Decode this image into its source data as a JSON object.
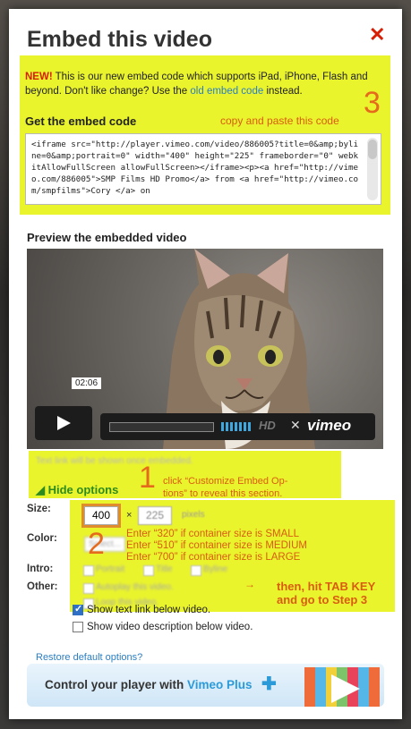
{
  "modal": {
    "title": "Embed this video",
    "close_label": "✕"
  },
  "embed": {
    "new_badge": "NEW!",
    "intro_text": " This is our new embed code which supports iPad, iPhone, Flash and beyond. Don't like change? Use the ",
    "old_link": "old embed code",
    "intro_end": " instead.",
    "heading": "Get the embed code",
    "code": "<iframe src=\"http://player.vimeo.com/video/886005?title=0&amp;byline=0&amp;portrait=0\" width=\"400\" height=\"225\" frameborder=\"0\" webkitAllowFullScreen allowFullScreen></iframe><p><a href=\"http://vimeo.com/886005\">SMP Films HD Promo</a> from <a href=\"http://vimeo.com/smpfilms\">Cory </a> on "
  },
  "preview": {
    "heading": "Preview the embedded video",
    "time": "02:06",
    "hd_label": "HD",
    "brand": "vimeo"
  },
  "options": {
    "text_link_note": "Text link will be shown once embedded.",
    "hide_label": "Hide options",
    "size_label": "Size:",
    "width_value": "400",
    "times": "×",
    "height_value": "225",
    "pixels": "pixels",
    "color_label": "Color:",
    "color_select": "Select...",
    "intro_label": "Intro:",
    "intro_portrait": "Portrait",
    "intro_title": "Title",
    "intro_byline": "Byline",
    "other_label": "Other:",
    "autoplay": "Autoplay this video.",
    "loop": "Loop this video.",
    "show_text_link": "Show text link below video.",
    "show_description": "Show video description below video.",
    "restore": "Restore default options?"
  },
  "annotations": {
    "copy": "copy and paste this code",
    "step1": "1",
    "step1_line1": "click “Customize Embed Op-",
    "step1_line2": "tions” to reveal this section.",
    "step2": "2",
    "step2_line1": "Enter “320” if container size is SMALL",
    "step2_line2": "Enter “510” if container size is MEDIUM",
    "step2_line3": "Enter “700” if container size is LARGE",
    "step3": "3",
    "arrow": "→",
    "tab_line1": "then, hit TAB KEY",
    "tab_line2": "and go to Step 3"
  },
  "banner": {
    "text": "Control your player with ",
    "brand": "Vimeo Plus",
    "plus": "✚"
  },
  "colors": {
    "highlight": "#eaf42d",
    "annotation": "#d95c12",
    "link": "#2b7ec1",
    "close": "#d81e05"
  }
}
